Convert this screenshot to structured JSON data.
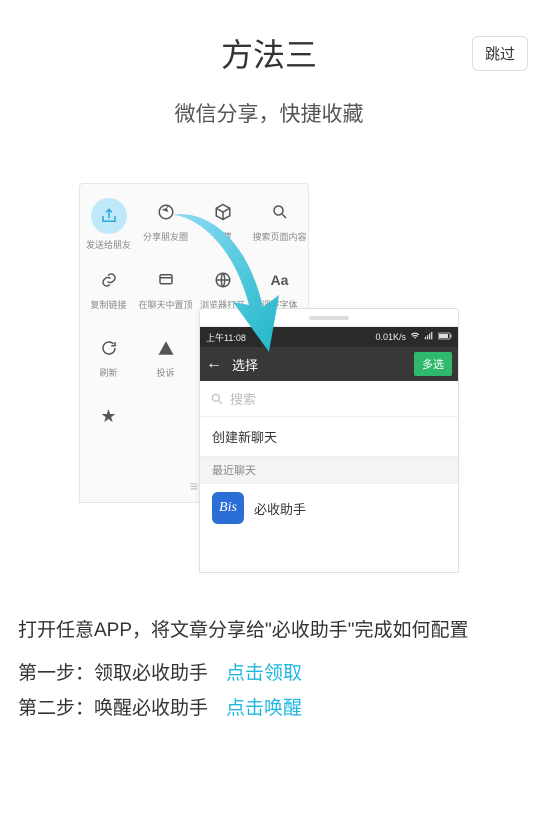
{
  "skip": "跳过",
  "title": "方法三",
  "subtitle": "微信分享，快捷收藏",
  "wechat_menu": {
    "row1": [
      {
        "name": "share-icon",
        "label": "发送给朋友",
        "highlight": true
      },
      {
        "name": "aperture-icon",
        "label": "分享朋友圈"
      },
      {
        "name": "cube-icon",
        "label": "收藏"
      },
      {
        "name": "search-icon",
        "label": "搜索页面内容"
      }
    ],
    "row2": [
      {
        "name": "link-icon",
        "label": "复制链接"
      },
      {
        "name": "pin-icon",
        "label": "在聊天中置顶"
      },
      {
        "name": "browser-icon",
        "label": "浏览器打开"
      },
      {
        "name": "font-icon",
        "label": "调整字体"
      }
    ],
    "row3": [
      {
        "name": "refresh-icon",
        "label": "刷新"
      },
      {
        "name": "report-icon",
        "label": "投诉"
      }
    ]
  },
  "overlay": {
    "status_time": "上午11:08",
    "status_net": "0.01K/s",
    "nav_title": "选择",
    "nav_multi": "多选",
    "search_placeholder": "搜索",
    "create_chat": "创建新聊天",
    "recent_label": "最近聊天",
    "chat_name": "必收助手",
    "chat_avatar_text": "Bis"
  },
  "body_text": "打开任意APP，将文章分享给\"必收助手\"完成如何配置",
  "steps": {
    "s1_label": "第一步：领取必收助手",
    "s1_link": "点击领取",
    "s2_label": "第二步：唤醒必收助手",
    "s2_link": "点击唤醒"
  }
}
